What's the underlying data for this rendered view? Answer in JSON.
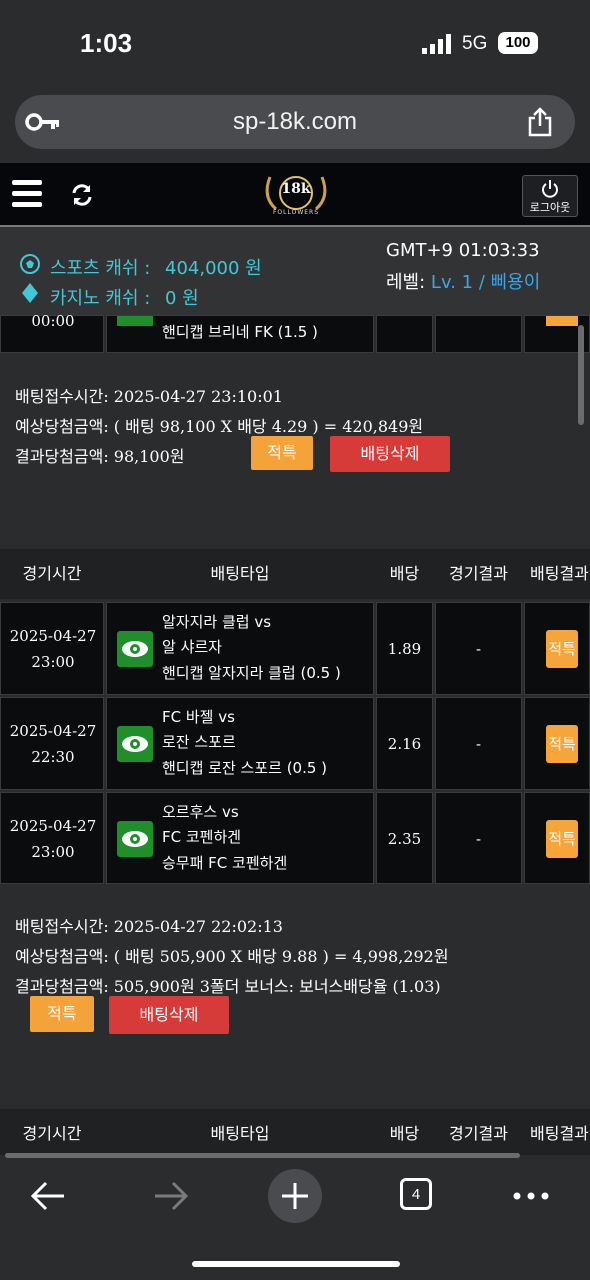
{
  "status_bar": {
    "time": "1:03",
    "network": "5G",
    "battery": "100"
  },
  "browser": {
    "url": "sp-18k.com"
  },
  "site": {
    "logo_text": "18k",
    "logo_sub": "FOLLOWERS",
    "logout_label": "로그아웃",
    "sports_cash_label": "스포츠 캐쉬 :",
    "sports_cash_value": "404,000 원",
    "casino_cash_label": "카지노 캐쉬 :",
    "casino_cash_value": "0 원",
    "gmt": "GMT+9 01:03:33",
    "level_label": "레벨:",
    "level_value": "Lv. 1 / 삐용이"
  },
  "partial_row": {
    "time": "00:00",
    "bet": "핸디캡 브리네 FK (1.5 )"
  },
  "slip1": {
    "time_label": "배팅접수시간: 2025-04-27 23:10:01",
    "expected": "예상당첨금액: ( 배팅 98,100 X 배당 4.29 ) = 420,849원",
    "result": "결과당첨금액: 98,100원",
    "hit_button": "적특",
    "delete_button": "배팅삭제"
  },
  "table_headers": [
    "경기시간",
    "배팅타입",
    "배당",
    "경기결과",
    "배팅결과"
  ],
  "rows": [
    {
      "date": "2025-04-27",
      "time": "23:00",
      "line1": "알자지라 클럽 vs",
      "line2": "알 샤르자",
      "line3": "핸디캡 알자지라 클럽 (0.5 )",
      "odds": "1.89",
      "result": "-",
      "status": "적특"
    },
    {
      "date": "2025-04-27",
      "time": "22:30",
      "line1": "FC 바젤 vs",
      "line2": "로잔 스포르",
      "line3": "핸디캡 로잔 스포르 (0.5 )",
      "odds": "2.16",
      "result": "-",
      "status": "적특"
    },
    {
      "date": "2025-04-27",
      "time": "23:00",
      "line1": "오르후스 vs",
      "line2": "FC 코펜하겐",
      "line3": "승무패 FC 코펜하겐",
      "odds": "2.35",
      "result": "-",
      "status": "적특"
    }
  ],
  "slip2": {
    "time_label": "배팅접수시간: 2025-04-27 22:02:13",
    "expected": "예상당첨금액: ( 배팅 505,900 X 배당 9.88 ) = 4,998,292원",
    "result": "결과당첨금액: 505,900원   3폴더 보너스: 보너스배당율 (1.03)",
    "hit_button": "적특",
    "delete_button": "배팅삭제"
  },
  "tabs_count": "4",
  "colors": {
    "accent_cyan": "#41c7d6",
    "orange": "#f4a33a",
    "red": "#d63b3a",
    "green": "#1e8f2a",
    "link_blue": "#3aa6e8"
  }
}
